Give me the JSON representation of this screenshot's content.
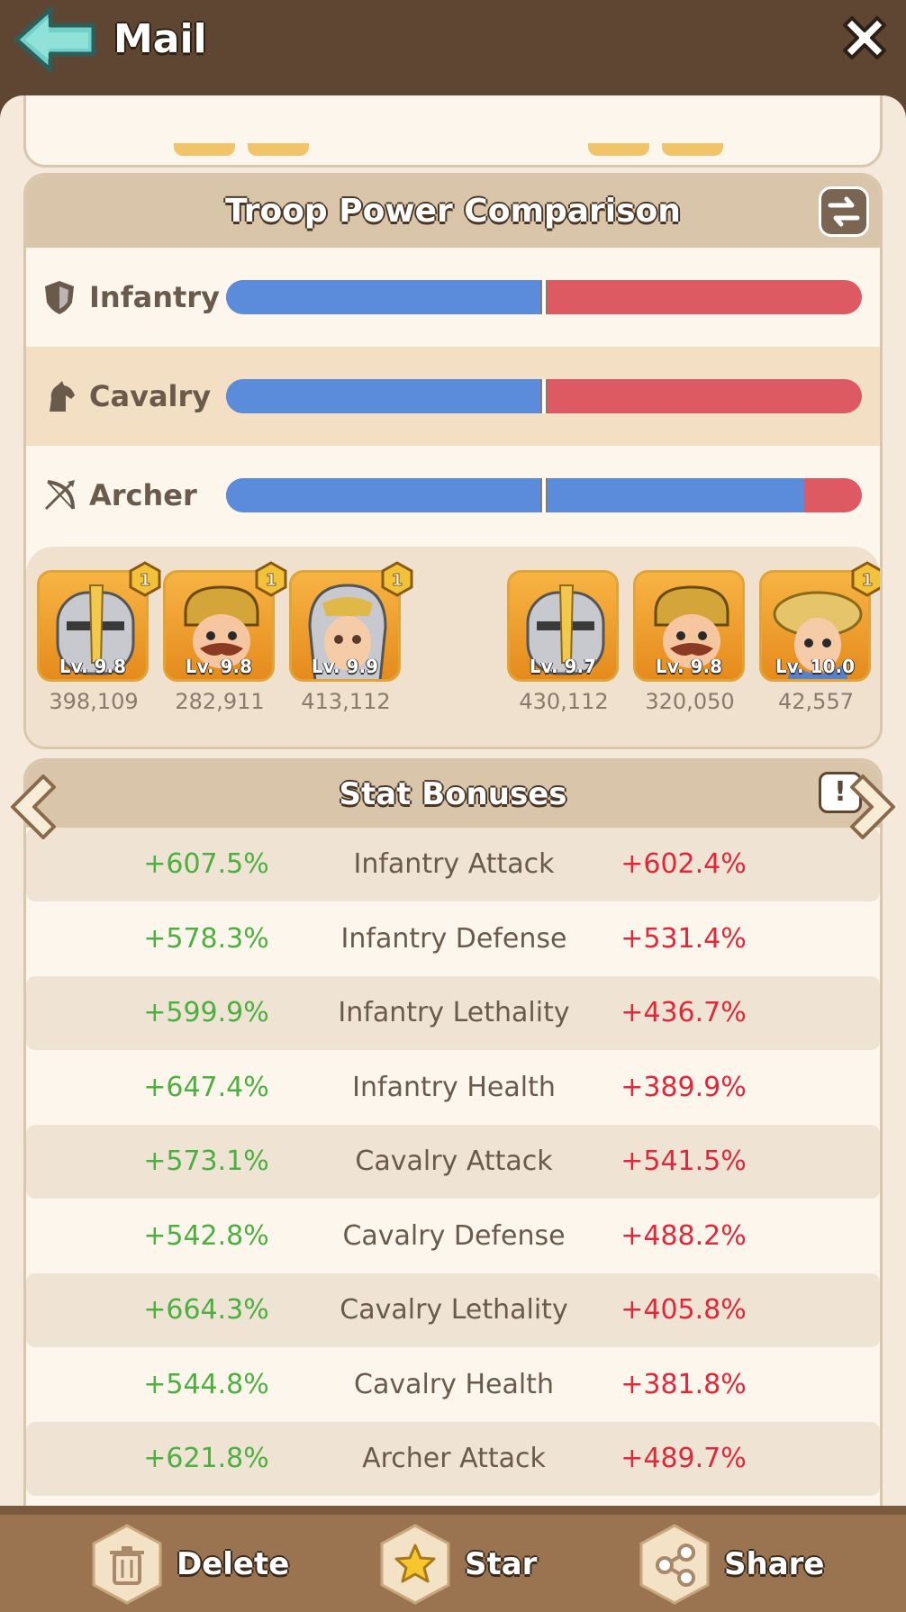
{
  "header": {
    "title": "Mail",
    "back_icon": "back-arrow-icon",
    "close_icon": "close-icon"
  },
  "troop_comparison": {
    "title": "Troop Power Comparison",
    "swap_icon": "swap-icon",
    "troops": [
      {
        "name": "Infantry",
        "icon": "shield-icon",
        "left_share": 0.5,
        "marker": 0.5
      },
      {
        "name": "Cavalry",
        "icon": "horse-icon",
        "left_share": 0.5,
        "marker": 0.5
      },
      {
        "name": "Archer",
        "icon": "bow-icon",
        "left_share": 0.91,
        "marker": 0.5
      }
    ],
    "colors": {
      "left": "#5b8cdc",
      "right": "#dd5a62"
    },
    "left_heroes": [
      {
        "level": "Lv. 9.8",
        "power": "398,109",
        "badge": "1",
        "type": "knight"
      },
      {
        "level": "Lv. 9.8",
        "power": "282,911",
        "badge": "1",
        "type": "king"
      },
      {
        "level": "Lv. 9.9",
        "power": "413,112",
        "badge": "1",
        "type": "valkyrie"
      }
    ],
    "right_heroes": [
      {
        "level": "Lv. 9.7",
        "power": "430,112",
        "badge": "",
        "type": "knight"
      },
      {
        "level": "Lv. 9.8",
        "power": "320,050",
        "badge": "",
        "type": "king"
      },
      {
        "level": "Lv. 10.0",
        "power": "42,557",
        "badge": "1",
        "type": "princess"
      }
    ]
  },
  "stat_bonuses": {
    "title": "Stat Bonuses",
    "info_label": "!",
    "rows": [
      {
        "left": "+607.5%",
        "name": "Infantry Attack",
        "right": "+602.4%"
      },
      {
        "left": "+578.3%",
        "name": "Infantry Defense",
        "right": "+531.4%"
      },
      {
        "left": "+599.9%",
        "name": "Infantry Lethality",
        "right": "+436.7%"
      },
      {
        "left": "+647.4%",
        "name": "Infantry Health",
        "right": "+389.9%"
      },
      {
        "left": "+573.1%",
        "name": "Cavalry Attack",
        "right": "+541.5%"
      },
      {
        "left": "+542.8%",
        "name": "Cavalry Defense",
        "right": "+488.2%"
      },
      {
        "left": "+664.3%",
        "name": "Cavalry Lethality",
        "right": "+405.8%"
      },
      {
        "left": "+544.8%",
        "name": "Cavalry Health",
        "right": "+381.8%"
      },
      {
        "left": "+621.8%",
        "name": "Archer Attack",
        "right": "+489.7%"
      }
    ],
    "colors": {
      "left": "#4caf3f",
      "right": "#e0283a"
    }
  },
  "footer": {
    "delete_label": "Delete",
    "star_label": "Star",
    "share_label": "Share"
  }
}
